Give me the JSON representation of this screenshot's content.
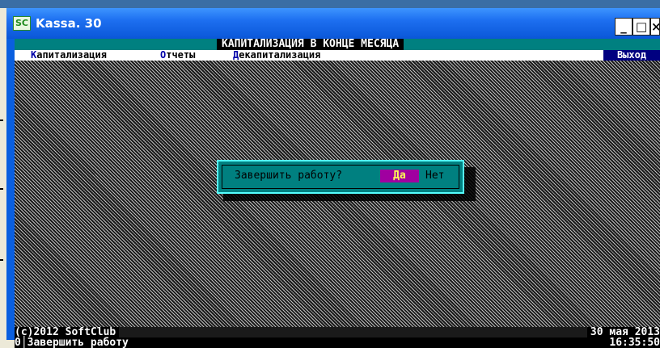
{
  "window": {
    "icon_text": "SC",
    "title": "Kassa. 30",
    "buttons": {
      "minimize": "_",
      "maximize": "□",
      "close": "×"
    }
  },
  "header": {
    "title": "КАПИТАЛИЗАЦИЯ В КОНЦЕ МЕСЯЦА"
  },
  "menu": {
    "items": [
      {
        "hotkey": "К",
        "rest": "апитализация"
      },
      {
        "hotkey": "О",
        "rest": "тчеты"
      },
      {
        "hotkey": "Д",
        "rest": "екапитализация"
      }
    ],
    "exit": "Выход"
  },
  "dialog": {
    "question": "Завершить работу?",
    "yes": "Да",
    "no": "Нет"
  },
  "status": {
    "copyright": "(c)2012 SoftClub",
    "date": "30 мая 2013",
    "hint": "0│Завершить работу",
    "time": "16:35:50"
  },
  "colors": {
    "title_bar": "#0a57d8",
    "header_bar": "#008080",
    "dialog_bg": "#008080",
    "yes_button": "#a000a0",
    "yes_text": "#ffff55",
    "exit_button": "#000080"
  }
}
